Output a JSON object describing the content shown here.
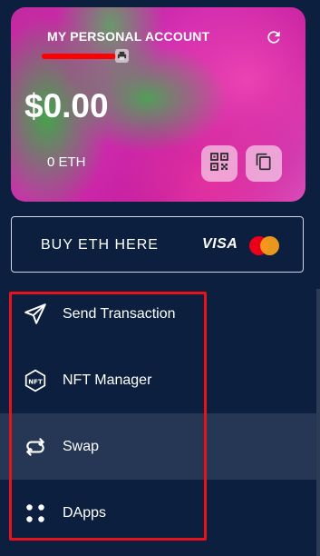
{
  "account": {
    "title": "MY PERSONAL ACCOUNT",
    "balance": "$0.00",
    "eth_balance": "0 ETH",
    "icons": [
      "refresh-icon",
      "print-icon",
      "qr-code-icon",
      "copy-icon"
    ]
  },
  "buy": {
    "label": "BUY ETH HERE",
    "visa": "VISA"
  },
  "menu": {
    "items": [
      {
        "label": "Send Transaction",
        "icon": "send-icon"
      },
      {
        "label": "NFT Manager",
        "icon": "nft-icon"
      },
      {
        "label": "Swap",
        "icon": "swap-icon"
      },
      {
        "label": "DApps",
        "icon": "dapps-icon"
      }
    ],
    "active": "Swap"
  },
  "colors": {
    "background": "#0c1f3e",
    "active_item": "#253754",
    "highlight_box": "#e8121b",
    "mastercard_red": "#eb001b",
    "mastercard_orange": "#f79e1b"
  }
}
